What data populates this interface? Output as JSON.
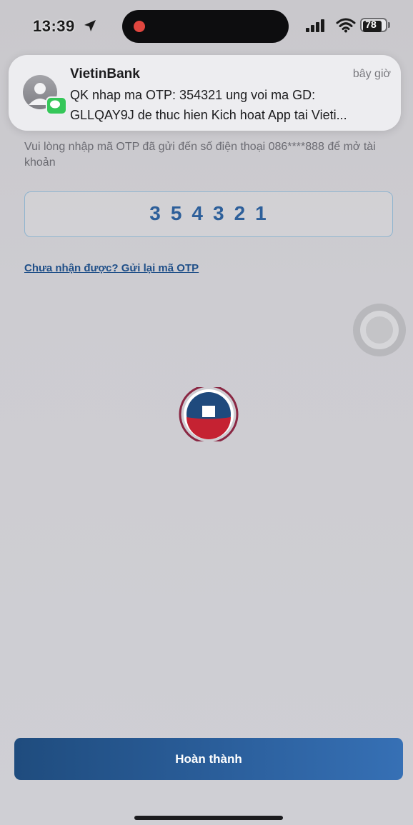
{
  "status_bar": {
    "time": "13:39",
    "battery": "78",
    "icons": [
      "location-arrow-icon",
      "recording-dot-icon",
      "cellular-signal-icon",
      "wifi-icon",
      "battery-icon"
    ]
  },
  "notification": {
    "app": "VietinBank",
    "time": "bây giờ",
    "line1": "QK nhap ma OTP: 354321 ung voi ma GD:",
    "line2": "GLLQAY9J de thuc hien Kich hoat App tai Vieti...",
    "icons": [
      "contact-avatar-icon",
      "messages-badge-icon"
    ]
  },
  "screen": {
    "instruction": "Vui lòng nhập mã OTP đã gửi đến số điện thoại 086****888 để mở tài khoản",
    "otp": "354321",
    "resend": "Chưa nhận được? Gửi lại mã OTP",
    "done": "Hoàn thành"
  },
  "colors": {
    "accent": "#2b5f9c",
    "otp_text": "#2d5f9a",
    "logo_red": "#c52232",
    "logo_blue": "#1f4a7d"
  }
}
